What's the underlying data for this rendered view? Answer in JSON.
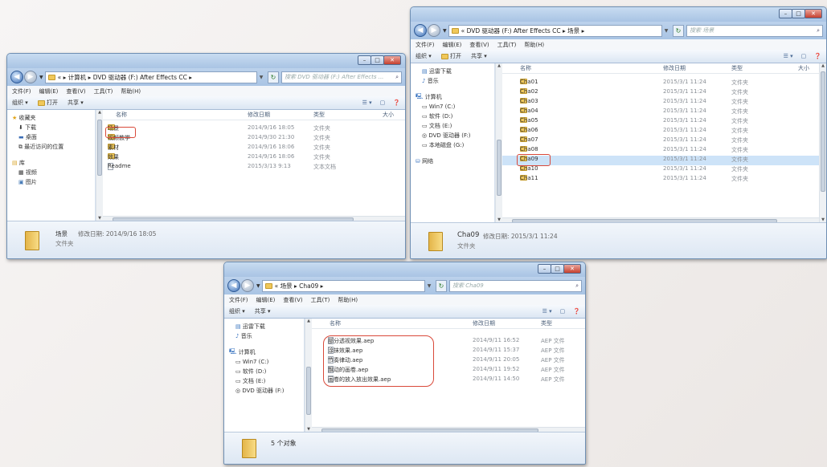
{
  "menu": [
    "文件(F)",
    "编辑(E)",
    "查看(V)",
    "工具(T)",
    "帮助(H)"
  ],
  "toolbar": {
    "organize": "组织 ▾",
    "open": "打开",
    "share": "共享 ▾"
  },
  "columns": {
    "name": "名称",
    "date": "修改日期",
    "type": "类型",
    "size": "大小"
  },
  "win1": {
    "breadcrumb": "« ▸ 计算机 ▸ DVD 驱动器 (F:) After Effects CC ▸",
    "search": "搜索 DVD 驱动器 (F:) After Effects ...",
    "nav": [
      "收藏夹",
      "下载",
      "桌面",
      "最近访问的位置",
      "库",
      "视频",
      "图片"
    ],
    "files": [
      {
        "name": "场景",
        "date": "2014/9/16 18:05",
        "type": "文件夹"
      },
      {
        "name": "视频教学",
        "date": "2014/9/30 21:30",
        "type": "文件夹"
      },
      {
        "name": "素材",
        "date": "2014/9/16 18:06",
        "type": "文件夹"
      },
      {
        "name": "效果",
        "date": "2014/9/16 18:06",
        "type": "文件夹"
      },
      {
        "name": "Readme",
        "date": "2015/3/13 9:13",
        "type": "文本文档"
      }
    ],
    "details_name": "场景",
    "details_date": "修改日期: 2014/9/16 18:05",
    "details_type": "文件夹"
  },
  "win2": {
    "breadcrumb": "« DVD 驱动器 (F:) After Effects CC ▸ 场景 ▸",
    "search": "搜索 场景",
    "nav": [
      "迅雷下载",
      "音乐",
      "计算机",
      "Win7 (C:)",
      "软件 (D:)",
      "文档 (E:)",
      "DVD 驱动器 (F:)",
      "本地磁盘 (G:)",
      "网络"
    ],
    "files": [
      {
        "name": "Cha01",
        "date": "2015/3/1 11:24",
        "type": "文件夹"
      },
      {
        "name": "Cha02",
        "date": "2015/3/1 11:24",
        "type": "文件夹"
      },
      {
        "name": "Cha03",
        "date": "2015/3/1 11:24",
        "type": "文件夹"
      },
      {
        "name": "Cha04",
        "date": "2015/3/1 11:24",
        "type": "文件夹"
      },
      {
        "name": "Cha05",
        "date": "2015/3/1 11:24",
        "type": "文件夹"
      },
      {
        "name": "Cha06",
        "date": "2015/3/1 11:24",
        "type": "文件夹"
      },
      {
        "name": "Cha07",
        "date": "2015/3/1 11:24",
        "type": "文件夹"
      },
      {
        "name": "Cha08",
        "date": "2015/3/1 11:24",
        "type": "文件夹"
      },
      {
        "name": "Cha09",
        "date": "2015/3/1 11:24",
        "type": "文件夹"
      },
      {
        "name": "Cha10",
        "date": "2015/3/1 11:24",
        "type": "文件夹"
      },
      {
        "name": "Cha11",
        "date": "2015/3/1 11:24",
        "type": "文件夹"
      }
    ],
    "details_name": "Cha09",
    "details_date": "修改日期: 2015/3/1 11:24",
    "details_type": "文件夹"
  },
  "win3": {
    "breadcrumb": "« 场景 ▸ Cha09 ▸",
    "search": "搜索 Cha09",
    "nav": [
      "迅雷下载",
      "音乐",
      "计算机",
      "Win7 (C:)",
      "软件 (D:)",
      "文档 (E:)",
      "DVD 驱动器 (F:)"
    ],
    "files": [
      {
        "name": "部分透视效果.aep",
        "date": "2014/9/11 16:52",
        "type": "AEP 文件"
      },
      {
        "name": "涂抹效果.aep",
        "date": "2014/9/11 15:37",
        "type": "AEP 文件"
      },
      {
        "name": "节奏律动.aep",
        "date": "2014/9/11 20:05",
        "type": "AEP 文件"
      },
      {
        "name": "飘动的画卷.aep",
        "date": "2014/9/11 19:52",
        "type": "AEP 文件"
      },
      {
        "name": "画卷的放入放出效果.aep",
        "date": "2014/9/11 14:50",
        "type": "AEP 文件"
      }
    ],
    "details_count": "5 个对象"
  }
}
